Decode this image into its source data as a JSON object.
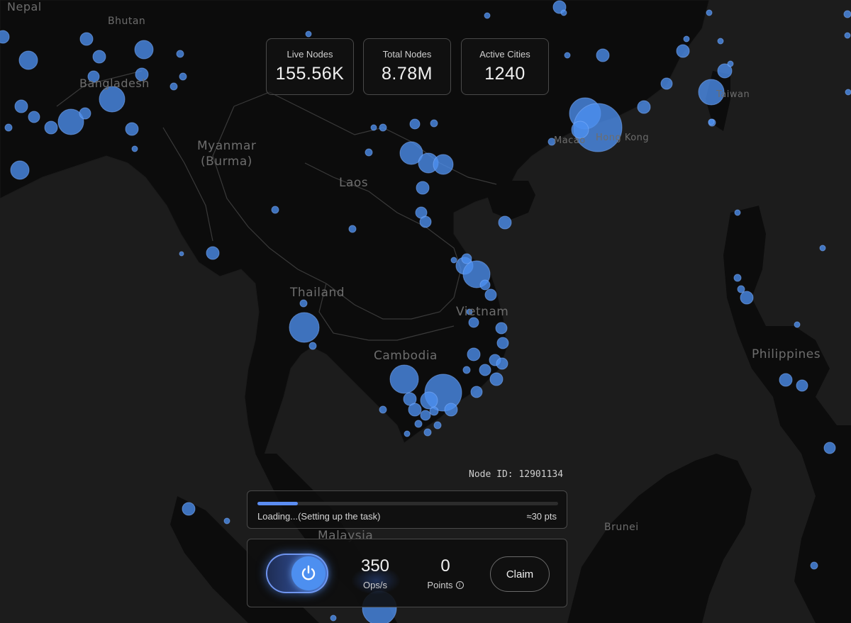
{
  "stats": [
    {
      "label": "Live Nodes",
      "value": "155.56K"
    },
    {
      "label": "Total Nodes",
      "value": "8.78M"
    },
    {
      "label": "Active Cities",
      "value": "1240"
    }
  ],
  "map": {
    "labels": {
      "nepal": "Nepal",
      "bhutan": "Bhutan",
      "bangladesh": "Bangladesh",
      "myanmar_1": "Myanmar",
      "myanmar_2": "(Burma)",
      "laos": "Laos",
      "thailand": "Thailand",
      "vietnam": "Vietnam",
      "cambodia": "Cambodia",
      "malaysia": "Malaysia",
      "brunei": "Brunei",
      "philippines": "Philippines",
      "hong_kong": "Hong Kong",
      "macao": "Macao",
      "taiwan": "Taiwan"
    },
    "node_color": "#4d8ff0"
  },
  "node": {
    "id_text": "Node ID: 12901134"
  },
  "progress": {
    "text": "Loading...(Setting up the task)",
    "points": "≈30 pts",
    "fraction": 0.135,
    "color": "#5b8df2"
  },
  "controls": {
    "ops_value": "350",
    "ops_label": "Ops/s",
    "points_value": "0",
    "points_label": "Points",
    "info_icon": "i",
    "claim_label": "Claim",
    "power_icon": "power-icon"
  }
}
